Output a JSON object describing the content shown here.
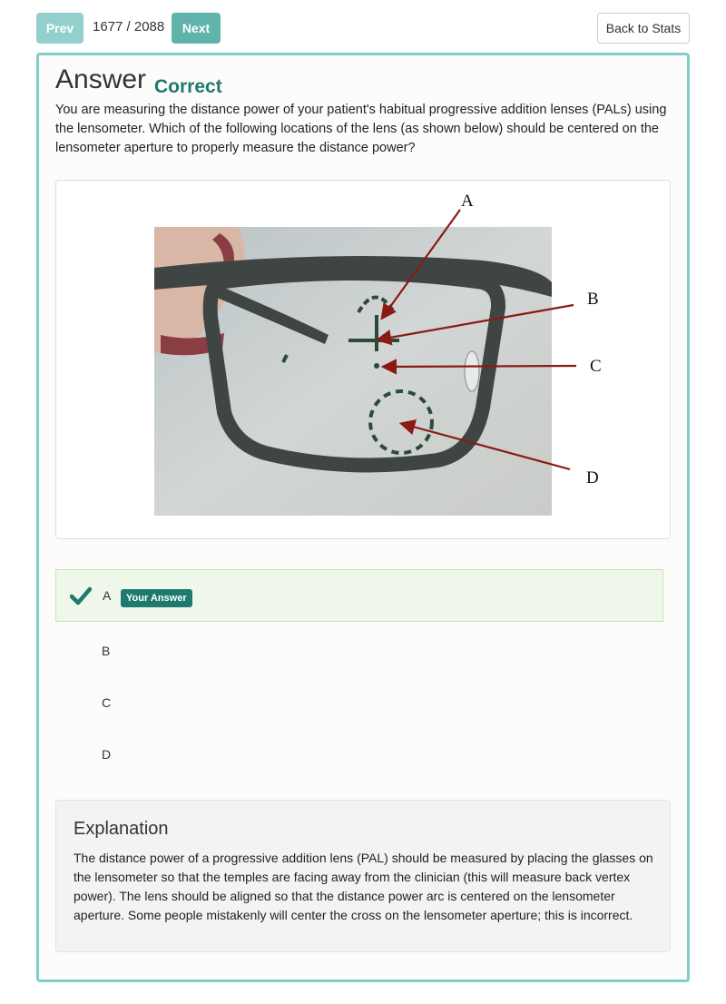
{
  "nav": {
    "prev_label": "Prev",
    "counter": "1677 / 2088",
    "next_label": "Next",
    "back_label": "Back to Stats"
  },
  "answer": {
    "title": "Answer",
    "result": "Correct"
  },
  "question": "You are measuring the distance power of your patient's habitual progressive addition lenses (PALs) using the lensometer. Which of the following locations of the lens (as shown below) should be centered on the lensometer aperture to properly measure the distance power?",
  "figure": {
    "labels": [
      "A",
      "B",
      "C",
      "D"
    ]
  },
  "choices": [
    {
      "label": "A",
      "selected": true,
      "badge": "Your Answer"
    },
    {
      "label": "B",
      "selected": false
    },
    {
      "label": "C",
      "selected": false
    },
    {
      "label": "D",
      "selected": false
    }
  ],
  "explanation": {
    "title": "Explanation",
    "text": "The distance power of a progressive addition lens (PAL) should be measured by placing the glasses on the lensometer so that the temples are facing away from the clinician (this will measure back vertex power). The lens should be aligned so that the distance power arc is centered on the lensometer aperture. Some people mistakenly will center the cross on the lensometer aperture; this is incorrect."
  },
  "colors": {
    "accent": "#5fb3ab",
    "border": "#7fcfc9",
    "correct": "#1e7a6e",
    "arrow": "#8b1a14"
  }
}
